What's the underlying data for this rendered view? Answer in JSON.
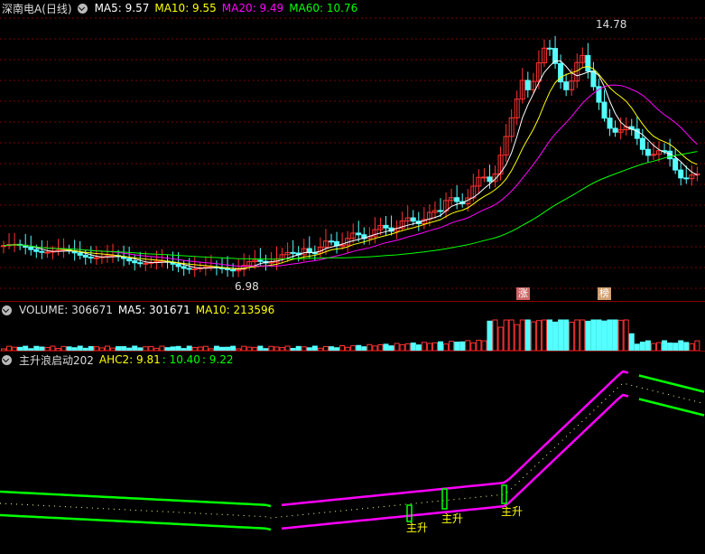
{
  "price_panel": {
    "stock": "深南电A(日线)",
    "ma5": "MA5: 9.57",
    "ma10": "MA10: 9.55",
    "ma20": "MA20: 9.49",
    "ma60": "MA60: 10.76",
    "high_label": "14.78",
    "low_label": "6.98",
    "tag_zhang": "涨",
    "tag_bang": "榜"
  },
  "volume_panel": {
    "volume": "VOLUME: 306671",
    "ma5": "MA5: 301671",
    "ma10": "MA10: 213596"
  },
  "indicator_panel": {
    "name": "主升浪启动202",
    "ahc2": "AHC2: 9.81",
    "v2": ": 10.40",
    "v3": ": 9.22",
    "signal_label": "主升"
  },
  "colors": {
    "up": "#ff3232",
    "down": "#54ffff",
    "ma5": "#ffffff",
    "ma10": "#ffff00",
    "ma20": "#ff00ff",
    "ma60": "#00ff00",
    "signal": "#00ff00"
  }
}
